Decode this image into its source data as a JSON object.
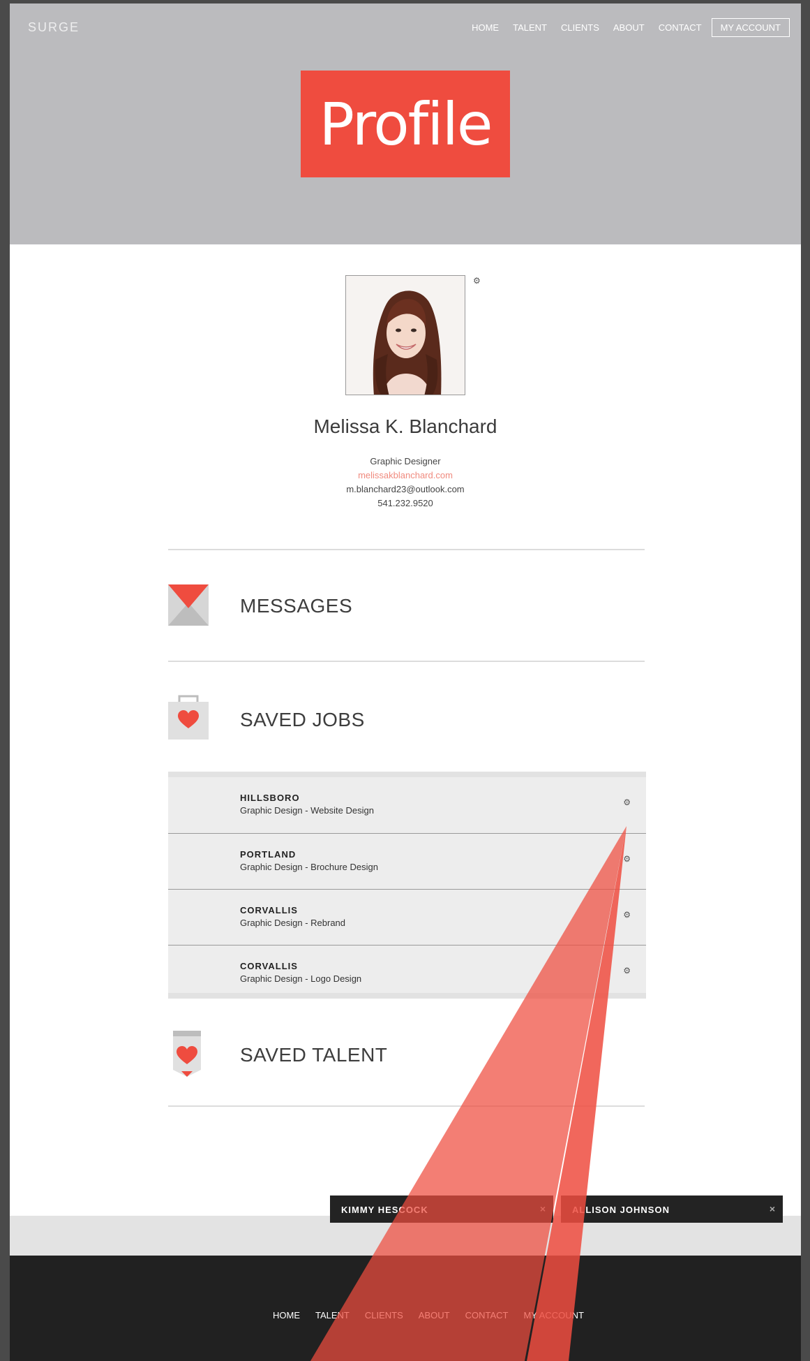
{
  "header": {
    "logo": "SURGE",
    "nav": {
      "home": "HOME",
      "talent": "TALENT",
      "clients": "CLIENTS",
      "about": "ABOUT",
      "contact": "CONTACT",
      "account": "MY ACCOUNT"
    },
    "title": "Profile"
  },
  "profile": {
    "name": "Melissa K. Blanchard",
    "role": "Graphic Designer",
    "website": "melissakblanchard.com",
    "email": "m.blanchard23@outlook.com",
    "phone": "541.232.9520"
  },
  "sections": {
    "messages": "MESSAGES",
    "saved_jobs": "SAVED JOBS",
    "saved_talent": "SAVED TALENT"
  },
  "saved_jobs": [
    {
      "city": "HILLSBORO",
      "desc": "Graphic Design - Website Design"
    },
    {
      "city": "PORTLAND",
      "desc": "Graphic Design - Brochure Design"
    },
    {
      "city": "CORVALLIS",
      "desc": "Graphic Design - Rebrand"
    },
    {
      "city": "CORVALLIS",
      "desc": "Graphic Design - Logo Design"
    }
  ],
  "chat": {
    "tab1": "KIMMY HESCOCK",
    "tab2": "ALLISON JOHNSON",
    "close_glyph": "×"
  },
  "footer": {
    "nav": {
      "home": "HOME",
      "talent": "TALENT",
      "clients": "CLIENTS",
      "about": "ABOUT",
      "contact": "CONTACT",
      "account": "MY ACCOUNT"
    }
  },
  "colors": {
    "accent": "#ef4c3f",
    "header_bg": "#bbbbbe",
    "footer_bg": "#212121",
    "link": "#f08a7e"
  },
  "icons": {
    "settings": "gear-icon",
    "messages": "envelope-icon",
    "saved_jobs": "bag-heart-icon",
    "saved_talent": "tag-heart-icon",
    "close": "close-icon"
  }
}
